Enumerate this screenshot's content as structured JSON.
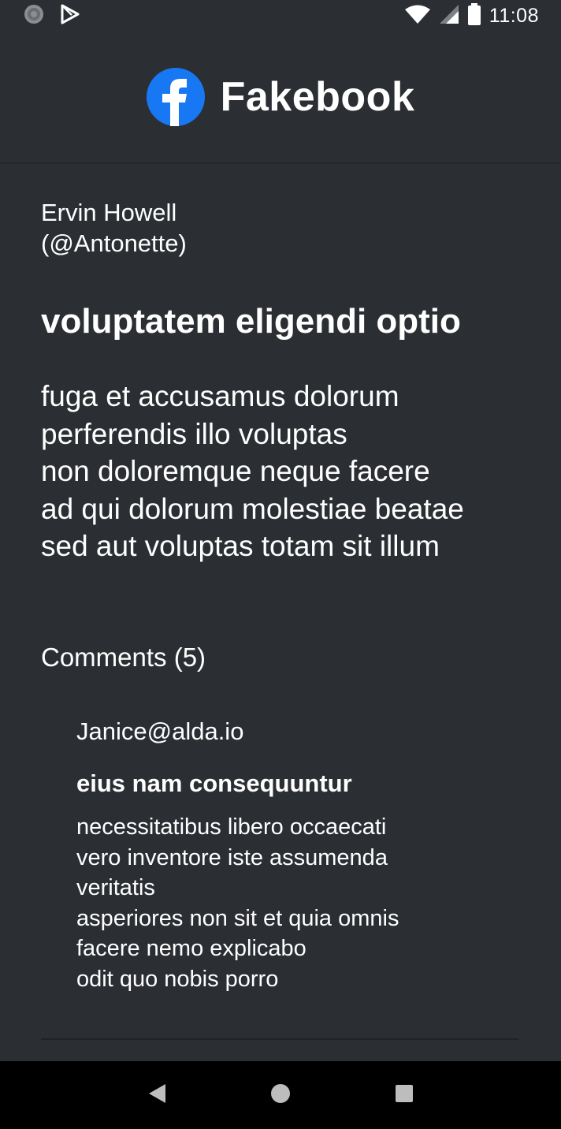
{
  "status_bar": {
    "time": "11:08",
    "left_icons": [
      "sync-icon",
      "play-store-icon"
    ],
    "right_icons": [
      "wifi-icon",
      "signal-icon",
      "battery-icon"
    ]
  },
  "header": {
    "app_name": "Fakebook",
    "logo_icon": "fakebook-logo-icon",
    "brand_color": "#1877f2"
  },
  "post": {
    "author_name": "Ervin Howell",
    "author_handle": "(@Antonette)",
    "title": "voluptatem eligendi optio",
    "body": "fuga et accusamus dolorum\nperferendis illo voluptas\nnon doloremque neque facere\nad qui dolorum molestiae beatae\nsed aut voluptas totam sit illum"
  },
  "comments": {
    "heading": "Comments (5)",
    "items": [
      {
        "email": "Janice@alda.io",
        "title": "eius nam consequuntur",
        "body": "necessitatibus libero occaecati\nvero inventore iste assumenda\nveritatis\nasperiores non sit et quia omnis\nfacere nemo explicabo\nodit quo nobis porro"
      }
    ]
  },
  "nav_bar": {
    "buttons": [
      "back-icon",
      "home-icon",
      "recents-icon"
    ]
  },
  "colors": {
    "background": "#2b2e33",
    "text": "#ffffff",
    "nav_background": "#000000"
  }
}
